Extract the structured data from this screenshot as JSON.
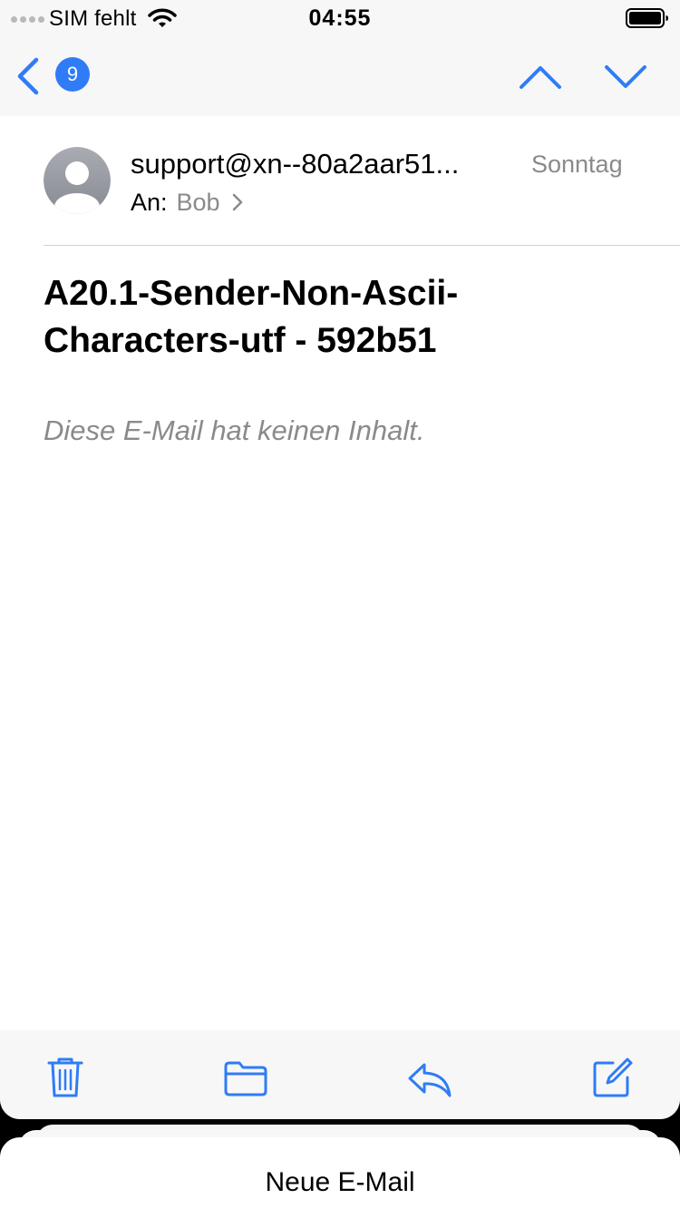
{
  "status_bar": {
    "carrier": "SIM fehlt",
    "time": "04:55",
    "icons": [
      "signal-dots-icon",
      "wifi-icon",
      "battery-icon"
    ]
  },
  "nav": {
    "back_icon": "chevron-left-icon",
    "unread_count": "9",
    "up_icon": "chevron-up-icon",
    "down_icon": "chevron-down-icon"
  },
  "message": {
    "sender": "support@xn--80a2aar51...",
    "date": "Sonntag",
    "to_label": "An:",
    "to_name": "Bob",
    "subject": "A20.1-Sender-Non-Ascii-Characters-utf - 592b51",
    "empty_body": "Diese E-Mail hat keinen Inhalt."
  },
  "toolbar": {
    "icons": [
      "trash-icon",
      "folder-icon",
      "reply-icon",
      "compose-icon"
    ]
  },
  "draft": {
    "title": "Neue E-Mail"
  },
  "colors": {
    "accent": "#2f7cf6",
    "secondary_text": "#8a8a8e",
    "bar_background": "#f7f7f8",
    "divider": "#d1d1d6"
  }
}
